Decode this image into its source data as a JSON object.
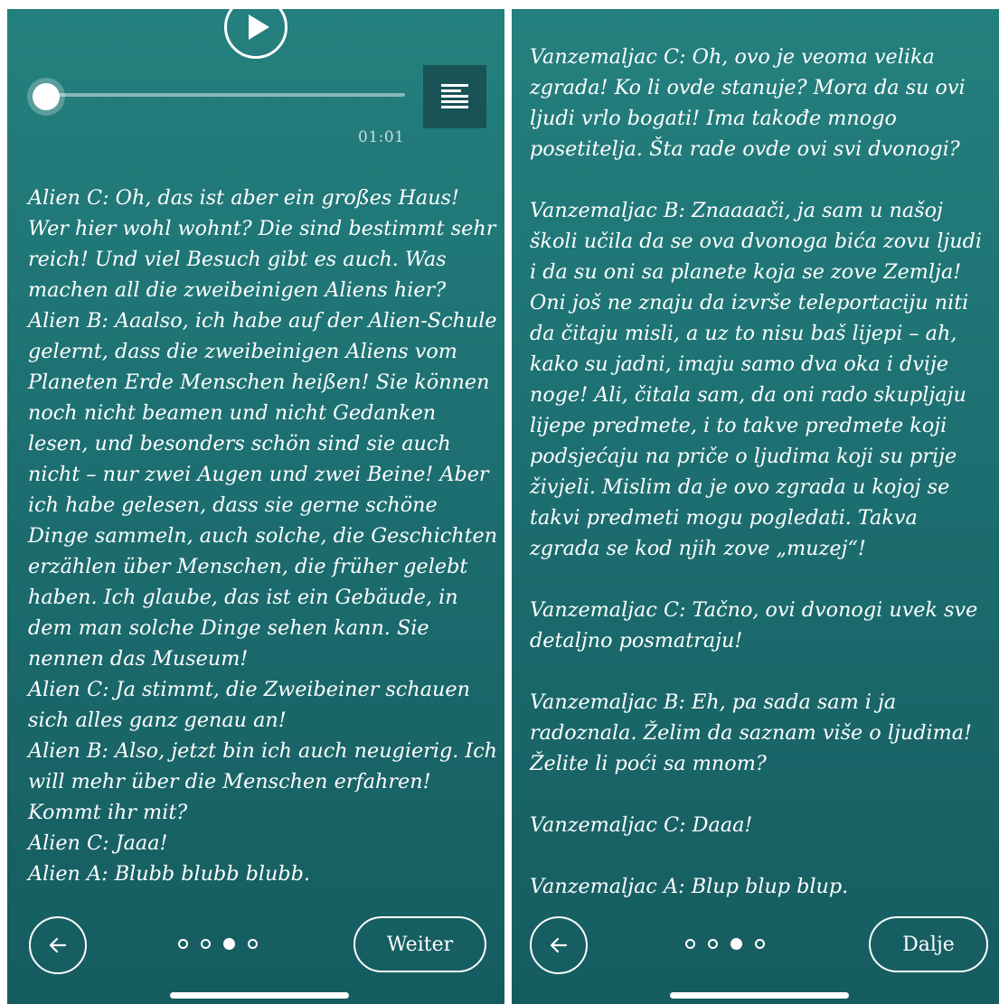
{
  "left": {
    "time": "01:01",
    "paragraphs": [
      "Alien C: Oh, das ist aber ein großes Haus! Wer hier wohl wohnt? Die sind bestimmt sehr reich! Und viel Besuch gibt es auch. Was machen all die zweibeinigen Aliens hier?",
      "Alien B: Aaalso, ich habe auf der Alien-Schule gelernt, dass die zweibeinigen Aliens vom Planeten Erde Menschen heißen! Sie können noch nicht beamen und nicht Gedanken lesen, und besonders schön sind sie auch nicht – nur zwei Augen und zwei Beine! Aber ich habe gelesen, dass sie gerne schöne Dinge sammeln, auch solche, die Geschichten erzählen über Menschen, die früher gelebt haben. Ich glaube, das ist ein Gebäude, in dem man solche Dinge sehen kann. Sie nennen das Museum!",
      "Alien C: Ja stimmt, die Zweibeiner schauen sich alles ganz genau an!",
      "Alien B: Also, jetzt bin ich auch neugierig. Ich will mehr über die Menschen erfahren! Kommt ihr mit?",
      "Alien C: Jaaa!",
      "Alien A: Blubb blubb blubb."
    ],
    "next_label": "Weiter",
    "page_indicator": {
      "total": 4,
      "current": 3
    }
  },
  "right": {
    "paragraphs": [
      "Vanzemaljac C: Oh, ovo je veoma velika zgrada! Ko li ovde stanuje? Mora da su ovi ljudi vrlo bogati! Ima takođe mnogo posetitelja. Šta rade ovde ovi svi dvonogi?",
      "Vanzemaljac B: Znaaaači, ja sam u našoj školi učila da se ova dvonoga bića zovu ljudi i da su oni sa planete koja se zove Zemlja! Oni još ne znaju da izvrše teleportaciju niti da čitaju misli, a uz to nisu baš lijepi – ah, kako su jadni, imaju samo dva oka i dvije noge! Ali, čitala sam, da oni rado skupljaju lijepe predmete, i to takve predmete koji podsjećaju na priče o ljudima koji su prije živjeli. Mislim da je ovo zgrada u kojoj se takvi predmeti mogu pogledati. Takva zgrada se kod njih zove „muzej“!",
      "Vanzemaljac C: Tačno, ovi dvonogi uvek sve detaljno posmatraju!",
      "Vanzemaljac B: Eh, pa sada sam i ja radoznala. Želim da saznam više o ljudima! Želite li poći sa mnom?",
      "Vanzemaljac C: Daaa!",
      "Vanzemaljac A: Blup blup blup."
    ],
    "next_label": "Dalje",
    "page_indicator": {
      "total": 4,
      "current": 3
    }
  },
  "audio": {
    "progress": 0.0
  },
  "colors": {
    "panel_top": "#24807e",
    "panel_bottom": "#155c60",
    "toggle_bg": "#195356",
    "text": "#ffffff"
  },
  "icons": [
    "play-icon",
    "text-lines-icon",
    "arrow-left-icon"
  ]
}
